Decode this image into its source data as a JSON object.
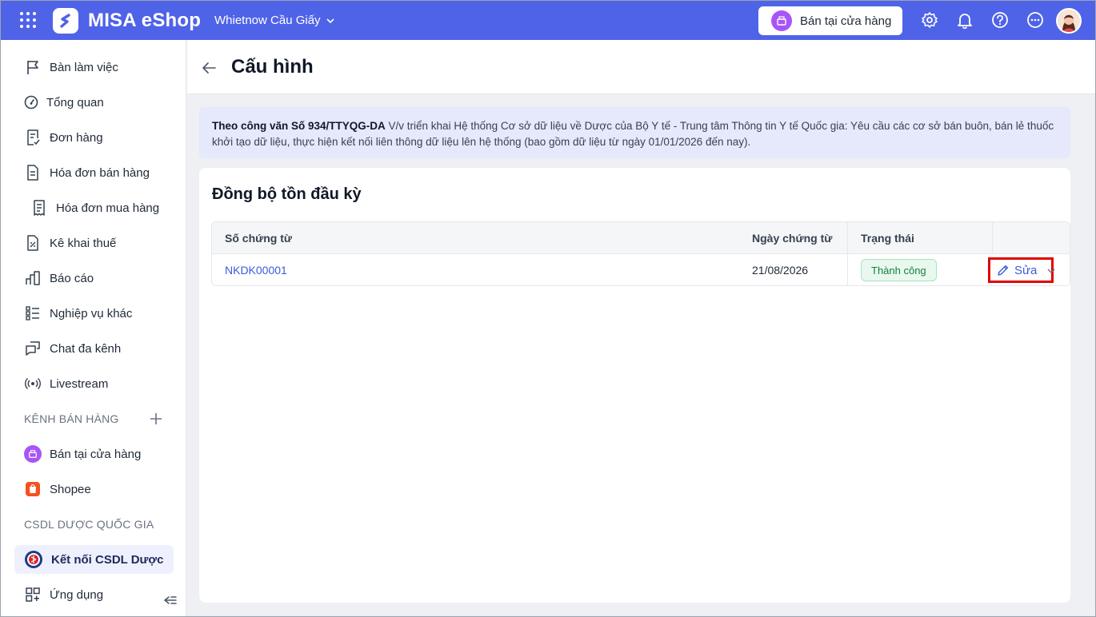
{
  "topbar": {
    "brand": "MISA eShop",
    "branch": "Whietnow Cầu Giấy",
    "sell_button": "Bán tại cửa hàng"
  },
  "sidebar": {
    "items": [
      {
        "label": "Bàn làm việc",
        "icon": "flag-icon"
      },
      {
        "label": "Tổng quan",
        "icon": "dashboard-gauge-icon"
      },
      {
        "label": "Đơn hàng",
        "icon": "order-doc-icon"
      },
      {
        "label": "Hóa đơn bán hàng",
        "icon": "invoice-icon"
      },
      {
        "label": "Hóa đơn mua hàng",
        "icon": "receipt-icon"
      },
      {
        "label": "Kê khai thuế",
        "icon": "tax-doc-icon"
      },
      {
        "label": "Báo cáo",
        "icon": "bar-chart-icon"
      },
      {
        "label": "Nghiệp vụ khác",
        "icon": "list-icon"
      },
      {
        "label": "Chat đa kênh",
        "icon": "chat-icon"
      },
      {
        "label": "Livestream",
        "icon": "broadcast-icon"
      }
    ],
    "section_sales": "KÊNH BÁN HÀNG",
    "channels": [
      {
        "label": "Bán tại cửa hàng",
        "icon": "store-register-icon"
      },
      {
        "label": "Shopee",
        "icon": "shopee-bag-icon"
      }
    ],
    "section_pharma": "CSDL DƯỢC QUỐC GIA",
    "pharma_item": "Kết nối CSDL Dược",
    "apps_item": "Ứng dụng"
  },
  "page": {
    "title": "Cấu hình",
    "notice_bold": "Theo công văn Số 934/TTYQG-DA",
    "notice_text": " V/v triển khai Hệ thống Cơ sở dữ liệu về Dược của Bộ Y tế - Trung tâm Thông tin Y tế Quốc gia: Yêu cầu các cơ sở bán buôn, bán lẻ thuốc khởi tạo dữ liệu, thực hiện kết nối liên thông dữ liệu lên hệ thống (bao gồm dữ liệu từ ngày 01/01/2026 đến nay).",
    "section_title": "Đồng bộ tồn đầu kỳ"
  },
  "table": {
    "headers": {
      "doc_no": "Số chứng từ",
      "doc_date": "Ngày chứng từ",
      "status": "Trạng thái"
    },
    "rows": [
      {
        "doc_no": "NKDK00001",
        "doc_date": "21/08/2026",
        "status": "Thành công",
        "action": "Sửa"
      }
    ]
  },
  "colors": {
    "primary": "#4f63e8",
    "link": "#3b5bdb",
    "success": "#15803d",
    "highlight": "#e00000"
  }
}
